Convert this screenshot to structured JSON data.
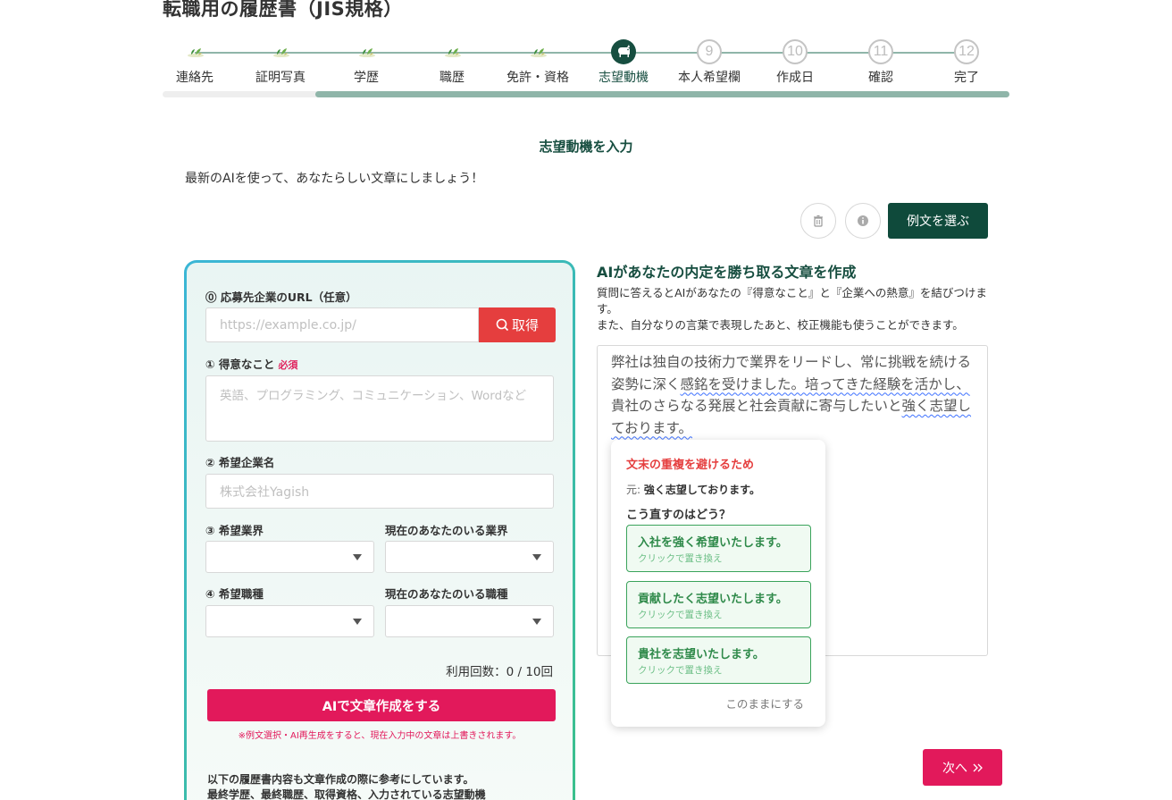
{
  "page": {
    "title": "転職用の履歴書（JIS規格）"
  },
  "stepper": {
    "steps": [
      {
        "label": "連絡先",
        "status": "done"
      },
      {
        "label": "証明写真",
        "status": "done"
      },
      {
        "label": "学歴",
        "status": "done"
      },
      {
        "label": "職歴",
        "status": "done"
      },
      {
        "label": "免許・資格",
        "status": "done"
      },
      {
        "label": "志望動機",
        "status": "current"
      },
      {
        "label": "本人希望欄",
        "status": "future",
        "number": "9"
      },
      {
        "label": "作成日",
        "status": "future",
        "number": "10"
      },
      {
        "label": "確認",
        "status": "future",
        "number": "11"
      },
      {
        "label": "完了",
        "status": "future",
        "number": "12"
      }
    ],
    "progress_fraction": 0.82
  },
  "section": {
    "title": "志望動機を入力",
    "subtitle": "最新のAIを使って、あなたらしい文章にしましょう！"
  },
  "toolbar": {
    "examples_label": "例文を選ぶ"
  },
  "form": {
    "url_label": "⓪ 応募先企業のURL（任意）",
    "url_placeholder": "https://example.co.jp/",
    "fetch_label": "取得",
    "strength_label": "① 得意なこと",
    "required_label": "必須",
    "strength_placeholder": "英語、プログラミング、コミュニケーション、Wordなど",
    "company_label": "② 希望企業名",
    "company_placeholder": "株式会社Yagish",
    "industry_label": "③ 希望業界",
    "current_industry_label": "現在のあなたのいる業界",
    "job_label": "④ 希望職種",
    "current_job_label": "現在のあなたのいる職種",
    "usage": "利用回数：0 / 10回",
    "ai_button": "AIで文章作成をする",
    "ai_note": "※例文選択・AI再生成をすると、現在入力中の文章は上書きされます。",
    "ref_note_1": "以下の履歴書内容も文章作成の際に参考にしています。",
    "ref_note_2": "最終学歴、最終職歴、取得資格、入力されている志望動機"
  },
  "right": {
    "title": "AIがあなたの内定を勝ち取る文章を作成",
    "desc1": "質問に答えるとAIがあなたの『得意なこと』と『企業への熱意』を結びつけます。",
    "desc2": "また、自分なりの言葉で表現したあと、校正機能も使うことができます。",
    "text_segments": [
      {
        "t": "弊社は独自の技術力で業界をリードし、常に挑戦を続ける姿勢に深く",
        "u": false
      },
      {
        "t": "感銘を受けました。培ってきた経験を活かし、",
        "u": true
      },
      {
        "t": "貴社のさらなる発展と社会貢献に寄与したいと",
        "u": false
      },
      {
        "t": "強く志望しております。",
        "u": true
      }
    ]
  },
  "popup": {
    "title": "文末の重複を避けるため",
    "original_prefix": "元:",
    "original_text": "強く志望しております。",
    "question": "こう直すのはどう？",
    "suggestions": [
      {
        "text": "入社を強く希望いたします。",
        "hint": "クリックで置き換え"
      },
      {
        "text": "貢献したく志望いたします。",
        "hint": "クリックで置き換え"
      },
      {
        "text": "貴社を志望いたします。",
        "hint": "クリックで置き換え"
      }
    ],
    "keep_label": "このままにする"
  },
  "next_button": "次へ",
  "colors": {
    "primary_dark": "#0f4a3b",
    "accent_pink": "#e2195b",
    "fetch_red": "#e53e3e",
    "suggestion_green": "#3aa35b"
  }
}
